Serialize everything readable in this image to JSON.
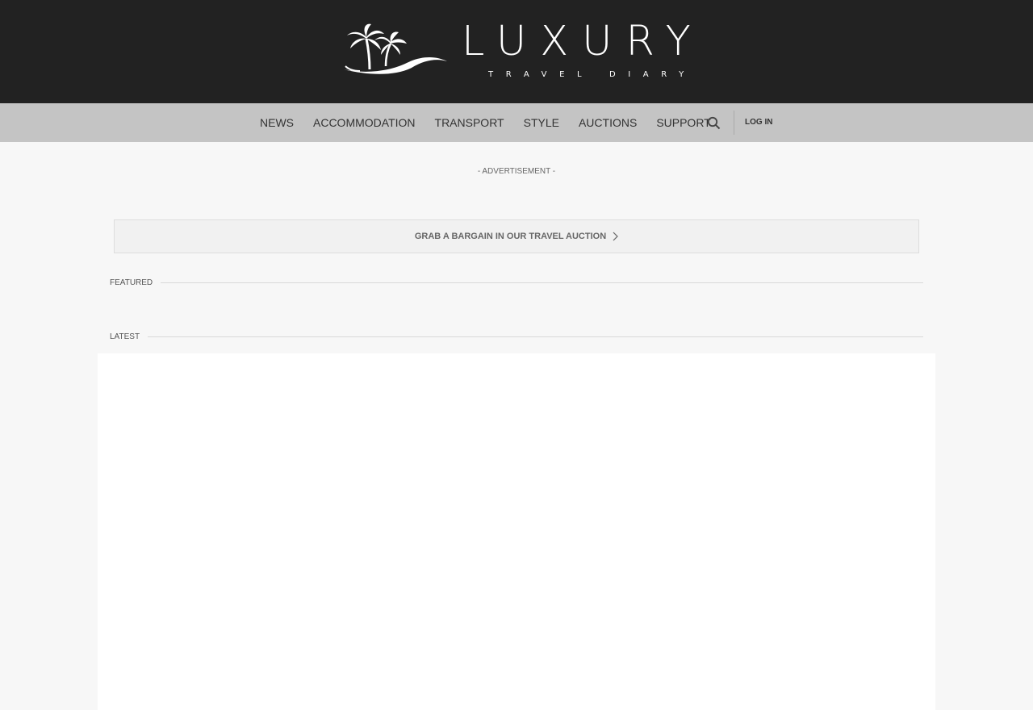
{
  "header": {
    "logo_wordmark": "LUXURY",
    "logo_tagline": "TRAVEL DIARY"
  },
  "nav": {
    "items": [
      {
        "label": "NEWS"
      },
      {
        "label": "ACCOMMODATION"
      },
      {
        "label": "TRANSPORT"
      },
      {
        "label": "STYLE"
      },
      {
        "label": "AUCTIONS"
      },
      {
        "label": "SUPPORT"
      }
    ],
    "search_icon": "search-icon",
    "login_label": "LOG IN"
  },
  "advertisement": {
    "label": "- ADVERTISEMENT -"
  },
  "auction_banner": {
    "label": "GRAB A BARGAIN IN OUR TRAVEL AUCTION",
    "icon": "chevron-right-icon"
  },
  "sections": {
    "featured": "FEATURED",
    "latest": "LATEST"
  },
  "colors": {
    "header_bg": "#222222",
    "nav_bg": "#c4c4c4",
    "page_bg": "#f7f7f7"
  }
}
